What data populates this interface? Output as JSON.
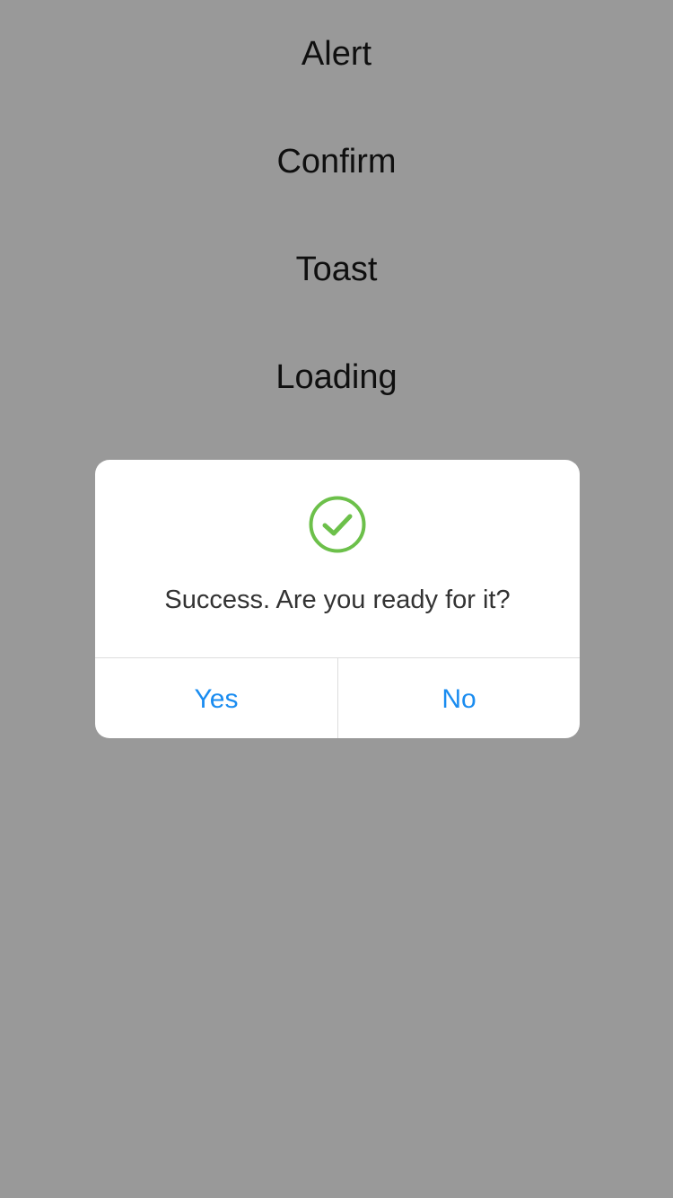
{
  "menu": {
    "items": [
      {
        "label": "Alert"
      },
      {
        "label": "Confirm"
      },
      {
        "label": "Toast"
      },
      {
        "label": "Loading"
      }
    ]
  },
  "dialog": {
    "icon": "success-check-circle-icon",
    "message": "Success. Are you ready for it?",
    "buttons": {
      "yes": "Yes",
      "no": "No"
    }
  },
  "colors": {
    "overlay": "rgba(0,0,0,0.4)",
    "accent": "#1a8cf0",
    "success": "#6cc04a",
    "text": "#1a1a1a"
  }
}
